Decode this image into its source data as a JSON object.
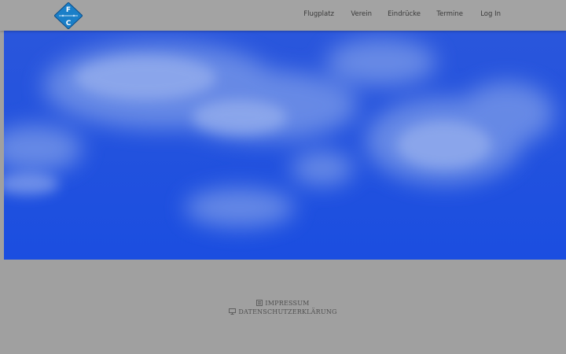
{
  "header": {
    "logo": {
      "icon": "fsc-diamond-logo",
      "letters": [
        "F",
        "C"
      ],
      "color": "#1a7fc8"
    },
    "nav": [
      {
        "label": "Flugplatz"
      },
      {
        "label": "Verein"
      },
      {
        "label": "Eindrücke"
      },
      {
        "label": "Termine"
      },
      {
        "label": "Log In"
      }
    ]
  },
  "hero": {
    "image": "blue-sky-with-clouds",
    "color": "#1c4fde"
  },
  "footer": {
    "links": [
      {
        "icon": "newspaper-icon",
        "label": "IMPRESSUM"
      },
      {
        "icon": "monitor-icon",
        "label": "DATENSCHUTZERKLÄRUNG"
      }
    ]
  }
}
